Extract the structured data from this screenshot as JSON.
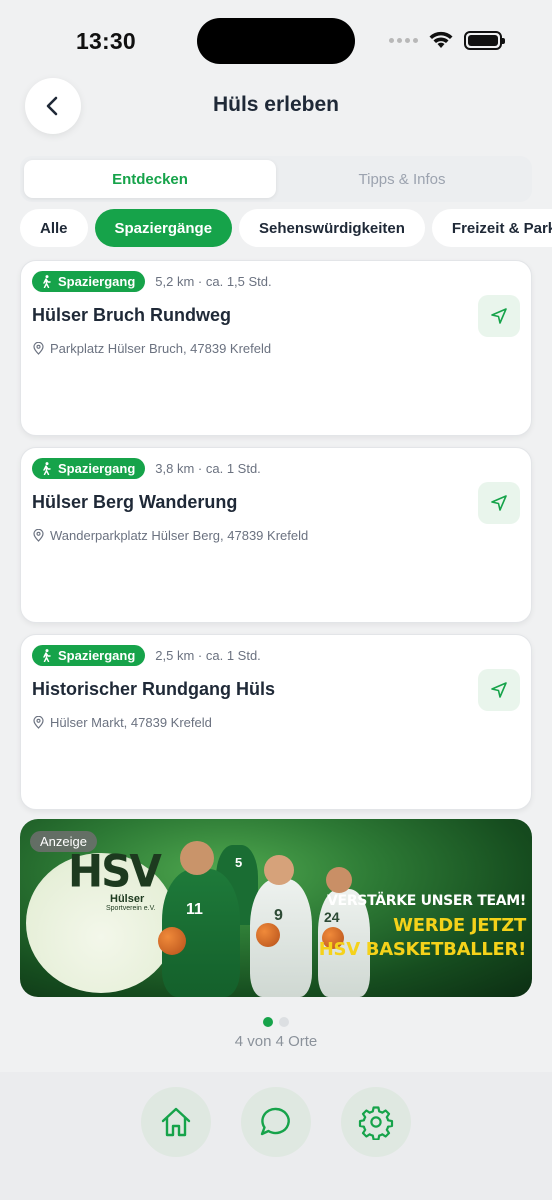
{
  "status_bar": {
    "time": "13:30"
  },
  "header": {
    "title": "Hüls erleben"
  },
  "tabs": [
    {
      "label": "Entdecken",
      "active": true
    },
    {
      "label": "Tipps & Infos",
      "active": false
    }
  ],
  "filters": [
    {
      "label": "Alle",
      "active": false
    },
    {
      "label": "Spaziergänge",
      "active": true
    },
    {
      "label": "Sehenswürdigkeiten",
      "active": false
    },
    {
      "label": "Freizeit & Parks",
      "active": false
    }
  ],
  "places": [
    {
      "badge": "Spaziergang",
      "meta": "5,2 km · ca. 1,5 Std.",
      "title": "Hülser Bruch Rundweg",
      "location": "Parkplatz Hülser Bruch, 47839 Krefeld"
    },
    {
      "badge": "Spaziergang",
      "meta": "3,8 km · ca. 1 Std.",
      "title": "Hülser Berg Wanderung",
      "location": "Wanderparkplatz Hülser Berg, 47839 Krefeld"
    },
    {
      "badge": "Spaziergang",
      "meta": "2,5 km · ca. 1 Std.",
      "title": "Historischer Rundgang Hüls",
      "location": "Hülser Markt, 47839 Krefeld"
    }
  ],
  "ad": {
    "label": "Anzeige",
    "logo": "HSV",
    "logo_sub1": "Hülser",
    "logo_sub2": "Sportverein e.V.",
    "jersey_numbers": [
      "11",
      "9",
      "24",
      "5"
    ],
    "line1": "VERSTÄRKE UNSER TEAM!",
    "line2": "WERDE JETZT",
    "line3": "HSV BASKETBALLER!"
  },
  "pager": {
    "count_text": "4 von 4 Orte",
    "pages": 2,
    "active_page": 1
  },
  "bottom_nav": [
    {
      "icon": "home-icon"
    },
    {
      "icon": "chat-icon"
    },
    {
      "icon": "settings-icon"
    }
  ],
  "colors": {
    "accent": "#16a34a",
    "accent_light": "#e9f5ec",
    "background": "#f0f1f2",
    "ad_highlight": "#f5d21a"
  }
}
